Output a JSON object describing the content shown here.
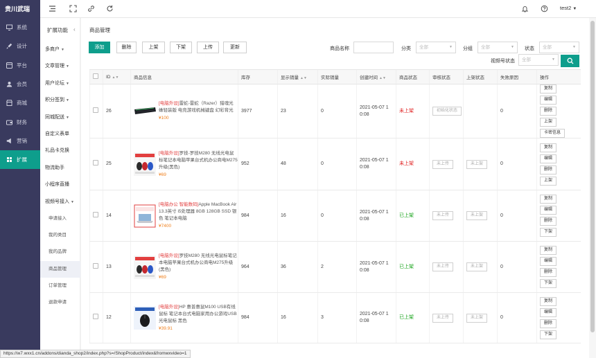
{
  "brand": "贵川武瑞",
  "sidebar": {
    "items": [
      {
        "label": "系统",
        "icon": "monitor-icon"
      },
      {
        "label": "设计",
        "icon": "brush-icon"
      },
      {
        "label": "平台",
        "icon": "platform-icon"
      },
      {
        "label": "会员",
        "icon": "user-icon"
      },
      {
        "label": "商城",
        "icon": "shop-icon"
      },
      {
        "label": "财务",
        "icon": "wallet-icon"
      },
      {
        "label": "营销",
        "icon": "megaphone-icon"
      },
      {
        "label": "扩展",
        "icon": "extension-icon",
        "active": true
      }
    ]
  },
  "topbar": {
    "icons": [
      "menu-toggle-icon",
      "fullscreen-icon",
      "link-icon",
      "refresh-icon",
      "bell-icon",
      "help-icon"
    ],
    "user": "test2"
  },
  "submenu": {
    "title": "扩展功能",
    "items": [
      {
        "label": "多商户",
        "caret": true
      },
      {
        "label": "文章管理",
        "caret": true
      },
      {
        "label": "用户论坛",
        "caret": true
      },
      {
        "label": "积分签到",
        "caret": true
      },
      {
        "label": "同城配送",
        "caret": true
      },
      {
        "label": "自定义表单",
        "caret": false
      },
      {
        "label": "礼品卡兑换",
        "caret": false
      },
      {
        "label": "物流助手",
        "caret": false
      },
      {
        "label": "小程序直播",
        "caret": false
      },
      {
        "label": "视频号接入",
        "caret": true,
        "expanded": true
      }
    ],
    "children": [
      {
        "label": "申请接入"
      },
      {
        "label": "我的类目"
      },
      {
        "label": "我的品牌"
      },
      {
        "label": "商品管理",
        "active": true
      },
      {
        "label": "订单管理"
      },
      {
        "label": "退款申请"
      }
    ]
  },
  "main": {
    "breadcrumb": "商品管理",
    "buttons": {
      "add": "添加",
      "delete": "删除",
      "on_shelf": "上架",
      "off_shelf": "下架",
      "upload": "上传",
      "update": "更新"
    },
    "filters": {
      "name_label": "商品名称",
      "name_value": "",
      "category_label": "分类",
      "category_value": "全部",
      "group_label": "分组",
      "group_value": "全部",
      "status_label": "状态",
      "status_value": "全部",
      "video_status_label": "视频号状态",
      "video_status_value": "全部",
      "search_icon": "search-icon"
    },
    "table": {
      "headers": [
        "ID",
        "商品信息",
        "库存",
        "显示销量",
        "实际销量",
        "创建时间",
        "商品状态",
        "审核状态",
        "上架状态",
        "失败原因",
        "操作"
      ],
      "rows": [
        {
          "id": "26",
          "tag": "[电脑外设]",
          "title": "雷蛇-雷蛇（Razer）猎魂光蛛轻装版 电竞游戏机械键盘 幻彩背光",
          "price": "¥100",
          "thumb": "keyboard",
          "stock": "3977",
          "display_sales": "23",
          "actual_sales": "0",
          "created": "2021-05-07 10:08",
          "status": "未上架",
          "status_type": "off",
          "audit": "初始化状态",
          "shelf": "",
          "reason": "0",
          "ops": [
            "复制",
            "编辑",
            "删除",
            "上架",
            "卡密信息"
          ]
        },
        {
          "id": "25",
          "tag": "[电脑外设]",
          "title": "罗技-罗技M280 无线光电鼠标笔记本电脑苹果台式机办公商电M275升级(黑色)",
          "price": "¥69",
          "thumb": "mice",
          "stock": "952",
          "display_sales": "48",
          "actual_sales": "0",
          "created": "2021-05-07 10:08",
          "status": "未上架",
          "status_type": "off",
          "audit": "未上传",
          "shelf": "未上架",
          "reason": "0",
          "ops": [
            "复制",
            "编辑",
            "删除",
            "上架"
          ]
        },
        {
          "id": "14",
          "tag": "[电脑办公 智能数码]",
          "title": "Apple MacBook Air 13.3英寸 i5处理器 8GB 128GB SSD 银色 笔记本电脑",
          "price": "¥7400",
          "thumb": "laptop",
          "stock": "984",
          "display_sales": "16",
          "actual_sales": "0",
          "created": "2021-05-07 10:08",
          "status": "已上架",
          "status_type": "on",
          "audit": "未上传",
          "shelf": "未上架",
          "reason": "0",
          "ops": [
            "复制",
            "编辑",
            "删除",
            "下架"
          ]
        },
        {
          "id": "13",
          "tag": "[电脑外设]",
          "title": "罗技M280 无线光电鼠标笔记本电脑苹果台式机办公商电M275升级(黑色)",
          "price": "¥69",
          "thumb": "mice",
          "stock": "964",
          "display_sales": "36",
          "actual_sales": "2",
          "created": "2021-05-07 10:08",
          "status": "已上架",
          "status_type": "on",
          "audit": "未上传",
          "shelf": "未上架",
          "reason": "0",
          "ops": [
            "复制",
            "编辑",
            "删除",
            "下架"
          ]
        },
        {
          "id": "12",
          "tag": "[电脑外设]",
          "title": "HP 惠普惠鼠M100 USB有线鼠标 笔记本台式电脑家用办公游戏USB光电鼠标 黑色",
          "price": "¥39.91",
          "thumb": "mouse",
          "stock": "984",
          "display_sales": "16",
          "actual_sales": "3",
          "created": "2021-05-07 10:08",
          "status": "已上架",
          "status_type": "on",
          "audit": "未上传",
          "shelf": "未上架",
          "reason": "0",
          "ops": [
            "复制",
            "编辑",
            "删除",
            "下架"
          ]
        }
      ]
    }
  },
  "status_url": "https://w7.wxx1.cn/addons/dianda_shop2/index.php?s=/ShopProduct/index&fromwxvideo=1",
  "colors": {
    "accent": "#0e9e8c",
    "sidebar_bg": "#393a5e",
    "status_off": "#e02020",
    "status_on": "#17a31a",
    "price": "#f0801d",
    "tag": "#e23f3f"
  }
}
